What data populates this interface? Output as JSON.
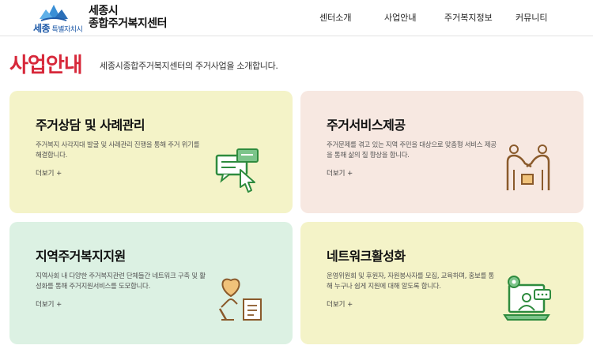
{
  "header": {
    "logo": {
      "sub_region": "세종",
      "sub_suffix": "특별자치시",
      "title_line1": "세종시",
      "title_line2": "종합주거복지센터"
    },
    "nav": [
      {
        "label": "센터소개"
      },
      {
        "label": "사업안내"
      },
      {
        "label": "주거복지정보"
      },
      {
        "label": "커뮤니티"
      }
    ]
  },
  "page": {
    "heading": "사업안내",
    "description": "세종시종합주거복지센터의 주거사업을 소개합니다."
  },
  "cards": [
    {
      "title": "주거상담 및 사례관리",
      "desc": "주거복지 사각지대 발굴 및 사례관리 진행을 통해 주거 위기를 해결합니다.",
      "more": "더보기 +",
      "bg": "#f4f3c8",
      "icon": "chat-pointer-icon"
    },
    {
      "title": "주거서비스제공",
      "desc": "주거문제를 겪고 있는 지역 주민을 대상으로 맞춤형 서비스 제공을 통해 삶의 질 향상을 합니다.",
      "more": "더보기 +",
      "bg": "#f7e8e1",
      "icon": "people-box-icon"
    },
    {
      "title": "지역주거복지지원",
      "desc": "지역사회 내 다양한 주거복지관련 단체들간 네트워크 구축 및 활성화를 통해 주거지원서비스를 도모합니다.",
      "more": "더보기 +",
      "bg": "#dcf1e3",
      "icon": "heart-hand-icon"
    },
    {
      "title": "네트워크활성화",
      "desc": "운영위원회 및 후원자, 자원봉사자를 모집, 교육하며, 홍보를 통해 누구나 쉽게 지원에 대해 알도록 합니다.",
      "more": "더보기 +",
      "bg": "#f4f3c8",
      "icon": "network-laptop-icon"
    }
  ],
  "colors": {
    "accent": "#d7283a",
    "brand_blue": "#1e5aa8",
    "icon_green": "#2e8b3e",
    "icon_brown": "#8a5a2b"
  }
}
